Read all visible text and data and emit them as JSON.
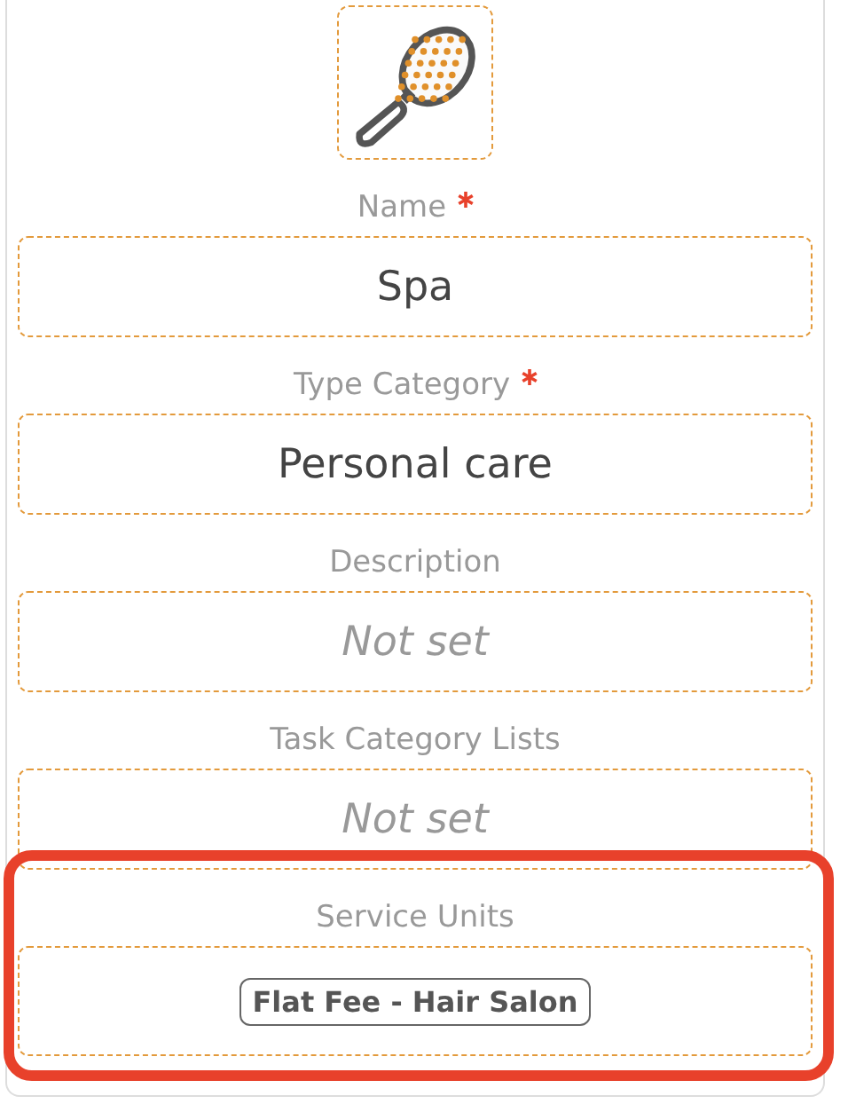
{
  "fields": [
    {
      "label": "Name",
      "required": true,
      "kind": "text",
      "value": "Spa",
      "highlighted": false
    },
    {
      "label": "Type Category",
      "required": true,
      "kind": "text",
      "value": "Personal care",
      "highlighted": false
    },
    {
      "label": "Description",
      "required": false,
      "kind": "empty",
      "placeholder": "Not set",
      "highlighted": false
    },
    {
      "label": "Task Category Lists",
      "required": false,
      "kind": "empty",
      "placeholder": "Not set",
      "highlighted": false
    },
    {
      "label": "Service Units",
      "required": false,
      "kind": "tags",
      "tags": [
        "Flat Fee - Hair Salon"
      ],
      "highlighted": true
    }
  ]
}
